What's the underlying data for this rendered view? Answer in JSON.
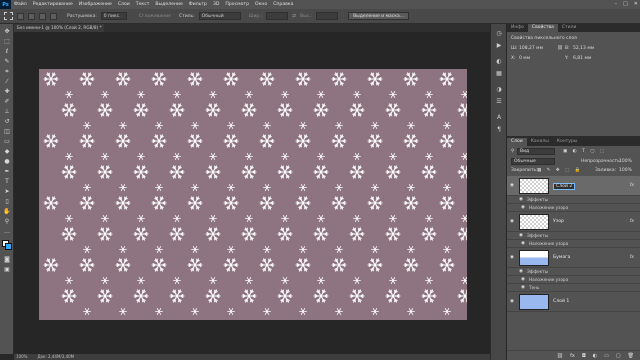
{
  "app": {
    "logo": "Ps"
  },
  "menu": [
    "Файл",
    "Редактирование",
    "Изображение",
    "Слои",
    "Текст",
    "Выделение",
    "Фильтр",
    "3D",
    "Просмотр",
    "Окно",
    "Справка"
  ],
  "window_controls": [
    "–",
    "□",
    "✕"
  ],
  "options": {
    "feather_label": "Растушевка:",
    "feather_value": "0 пикс.",
    "smoothing_label": "Сглаживание",
    "style_label": "Стиль:",
    "style_value": "Обычный",
    "width_label": "Шир.:",
    "height_label": "Выс.:",
    "refine_button": "Выделение и маска..."
  },
  "document": {
    "tab_title": "Без имени-1 @ 100% (Слой 2, RGB/8) *",
    "tab_close": "✕",
    "canvas_color": "#8e7480"
  },
  "status": {
    "zoom": "100%",
    "doc_size": "Док: 2,44M/3,40M"
  },
  "properties": {
    "tabs": [
      "Инфо",
      "Свойства",
      "Стили"
    ],
    "active_tab": "Свойства",
    "section_title": "Свойства пиксельного слоя",
    "w_label": "Ш:",
    "w_value": "108,27 мм",
    "h_label": "В:",
    "h_value": "52,13 мм",
    "x_label": "X:",
    "x_value": "0 мм",
    "y_label": "Y:",
    "y_value": "6,81 мм"
  },
  "layers_panel": {
    "tabs": [
      "Слои",
      "Каналы",
      "Контуры"
    ],
    "active_tab": "Слои",
    "filter_label": "Вид",
    "blend_mode": "Обычные",
    "opacity_label": "Непрозрачность:",
    "opacity_value": "100%",
    "lock_label": "Закрепить:",
    "fill_label": "Заливка:",
    "fill_value": "100%",
    "layers": [
      {
        "name": "Слой 2",
        "fx": "fx",
        "effects_label": "Эффекты",
        "effects": [
          "Наложение узора"
        ]
      },
      {
        "name": "Узор",
        "fx": "fx",
        "effects_label": "Эффекты",
        "effects": [
          "Наложение узора"
        ]
      },
      {
        "name": "Бумага",
        "fx": "fx",
        "effects_label": "Эффекты",
        "effects": [
          "Наложение узора",
          "Тень"
        ]
      },
      {
        "name": "Слой 1"
      }
    ],
    "bottom_icons": [
      "link-icon",
      "fx-icon",
      "mask-icon",
      "adjustment-icon",
      "folder-icon",
      "new-layer-icon",
      "trash-icon"
    ]
  },
  "colors": {
    "accent": "#31a8ff",
    "panel": "#535353",
    "bg": "#282828",
    "layer1_fill": "#9ab8f0"
  }
}
